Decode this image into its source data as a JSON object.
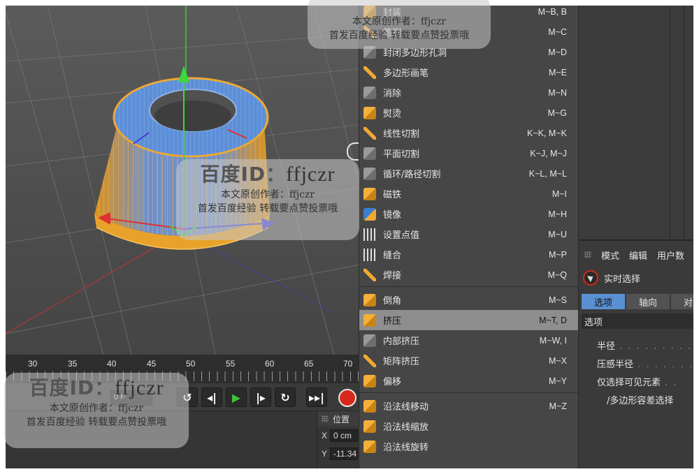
{
  "timeline": {
    "ticks": [
      "30",
      "35",
      "40",
      "45",
      "50",
      "55",
      "60",
      "65",
      "70"
    ]
  },
  "transport": {
    "frame_value": "0 F"
  },
  "coord_panel": {
    "title": "位置",
    "x_label": "X",
    "x_value": "0 cm",
    "y_label": "Y",
    "y_value": "-11.34"
  },
  "menu": {
    "items": [
      {
        "label": "封装",
        "key": "M~B, B",
        "icon": "cube-icon"
      },
      {
        "label": "笔刷",
        "key": "M~C",
        "icon": "brush-icon"
      },
      {
        "label": "封闭多边形孔洞",
        "key": "M~D",
        "icon": "close-hole-icon"
      },
      {
        "label": "多边形画笔",
        "key": "M~E",
        "icon": "polygon-pen-icon"
      },
      {
        "label": "消除",
        "key": "M~N",
        "icon": "dissolve-icon"
      },
      {
        "label": "熨烫",
        "key": "M~G",
        "icon": "iron-icon"
      },
      {
        "label": "线性切割",
        "key": "K~K, M~K",
        "icon": "line-cut-icon"
      },
      {
        "label": "平面切割",
        "key": "K~J, M~J",
        "icon": "plane-cut-icon"
      },
      {
        "label": "循环/路径切割",
        "key": "K~L, M~L",
        "icon": "loop-cut-icon"
      },
      {
        "label": "磁铁",
        "key": "M~I",
        "icon": "magnet-icon"
      },
      {
        "label": "镜像",
        "key": "M~H",
        "icon": "mirror-icon"
      },
      {
        "label": "设置点值",
        "key": "M~U",
        "icon": "set-point-icon"
      },
      {
        "label": "缝合",
        "key": "M~P",
        "icon": "stitch-icon"
      },
      {
        "label": "焊接",
        "key": "M~Q",
        "icon": "weld-icon"
      },
      {
        "label": "倒角",
        "key": "M~S",
        "icon": "bevel-icon"
      },
      {
        "label": "挤压",
        "key": "M~T, D",
        "icon": "extrude-icon"
      },
      {
        "label": "内部挤压",
        "key": "M~W, I",
        "icon": "extrude-inner-icon"
      },
      {
        "label": "矩阵挤压",
        "key": "M~X",
        "icon": "matrix-extrude-icon"
      },
      {
        "label": "偏移",
        "key": "M~Y",
        "icon": "offset-icon"
      },
      {
        "label": "沿法线移动",
        "key": "M~Z",
        "icon": "normal-move-icon"
      },
      {
        "label": "沿法线缩放",
        "key": "",
        "icon": "normal-scale-icon"
      },
      {
        "label": "沿法线旋转",
        "key": "",
        "icon": "normal-rotate-icon"
      }
    ]
  },
  "attributes": {
    "menubar": [
      "模式",
      "编辑",
      "用户数"
    ],
    "tool_name": "实时选择",
    "tabs": [
      "选项",
      "轴向",
      "对象"
    ],
    "section": "选项",
    "rows": [
      "半径",
      "压感半径",
      "仅选择可见元素",
      "/多边形容差选择"
    ]
  },
  "watermark": {
    "id_prefix": "百度ID：",
    "id_name": "ffjczr",
    "line1": "本文原创作者：ffjczr",
    "line2": "首发百度经验 转载要点赞投票哦"
  },
  "colors": {
    "accent_orange": "#f0a830",
    "wire_blue": "#4f86d6",
    "active_row": "#8e8e8e",
    "selected_tab": "#5b8fd3"
  }
}
